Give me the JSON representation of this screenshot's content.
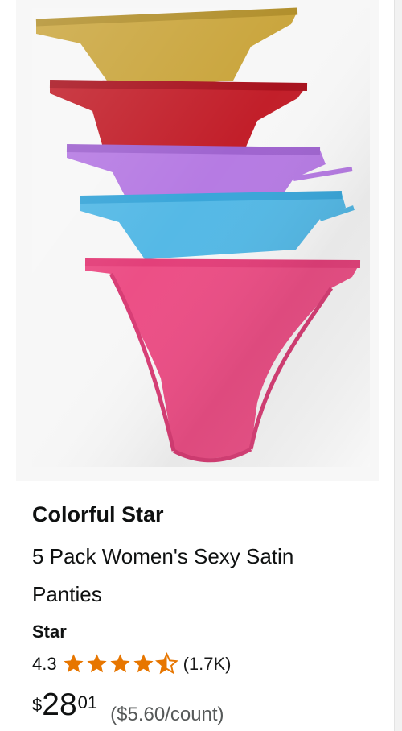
{
  "product": {
    "brand": "Colorful Star",
    "title_line1": "5 Pack Women's Sexy Satin",
    "title_line2": "Panties",
    "byline": "Star",
    "rating_value": "4.3",
    "rating_stars": 4.3,
    "rating_count": "(1.7K)",
    "price_symbol": "$",
    "price_whole": "28",
    "price_fraction": "01",
    "unit_price": "($5.60/count)",
    "star_color": "#e77600",
    "panty_colors": [
      "#c9a43a",
      "#c21f2a",
      "#b67be3",
      "#55b9e6",
      "#ec4f86"
    ]
  }
}
